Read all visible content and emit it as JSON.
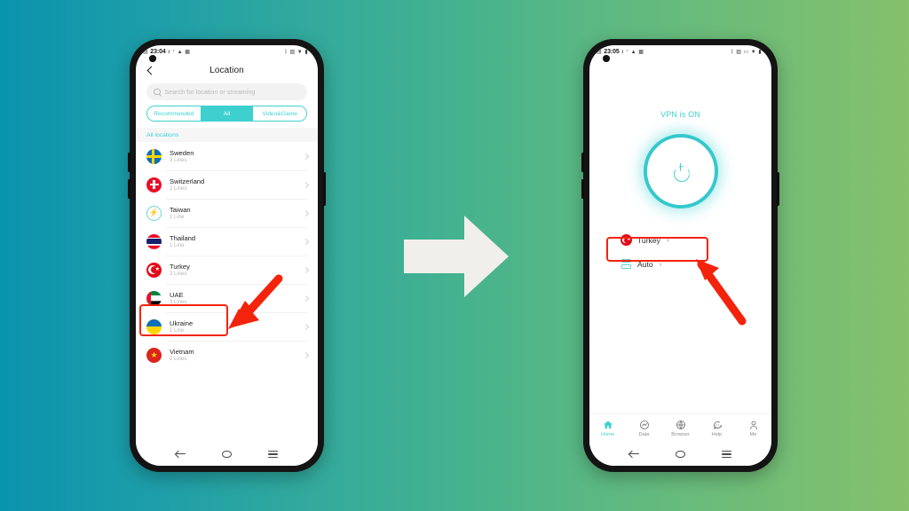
{
  "background": {
    "gradient_from": "#0a93ae",
    "gradient_to": "#85c06c"
  },
  "accent_color": "#3dd0cf",
  "highlight_color": "#f4230c",
  "center_arrow": {
    "name": "transition-arrow",
    "color": "#F0EFEA"
  },
  "left_phone": {
    "status_bar": {
      "time": "23:04",
      "left_icons": [
        "sim-icon",
        "download-icon",
        "bluetooth-small-icon",
        "alert-icon",
        "screenshot-icon"
      ],
      "right_icons": [
        "bluetooth-icon",
        "vibrate-icon",
        "wifi-icon",
        "battery-icon"
      ]
    },
    "header": {
      "title": "Location",
      "back_icon": "back-chevron-icon"
    },
    "search": {
      "placeholder": "Search for location or streaming",
      "icon": "search-icon"
    },
    "tabs": [
      {
        "label": "Recommended",
        "active": false
      },
      {
        "label": "All",
        "active": true
      },
      {
        "label": "Video&Game",
        "active": false
      }
    ],
    "section_title": "All locations",
    "locations": [
      {
        "name": "Sweden",
        "lines": "3 Lines",
        "flag": "flag-sweden"
      },
      {
        "name": "Switzerland",
        "lines": "2 Lines",
        "flag": "flag-switzerland"
      },
      {
        "name": "Taiwan",
        "lines": "1 Line",
        "flag": "icon-taiwan-bolt"
      },
      {
        "name": "Thailand",
        "lines": "1 Line",
        "flag": "flag-thailand"
      },
      {
        "name": "Turkey",
        "lines": "3 Lines",
        "flag": "flag-turkey",
        "highlighted": true
      },
      {
        "name": "UAE",
        "lines": "3 Lines",
        "flag": "flag-uae"
      },
      {
        "name": "Ukraine",
        "lines": "1 Line",
        "flag": "flag-ukraine"
      },
      {
        "name": "Vietnam",
        "lines": "2 Lines",
        "flag": "flag-vietnam"
      }
    ],
    "system_nav": [
      "back-icon",
      "home-icon",
      "recents-icon"
    ]
  },
  "right_phone": {
    "status_bar": {
      "time": "23:05",
      "left_icons": [
        "sim-icon",
        "download-icon",
        "bluetooth-small-icon",
        "alert-icon",
        "screenshot-icon"
      ],
      "right_icons": [
        "bluetooth-icon",
        "vibrate-icon",
        "vpn-icon",
        "wifi-icon",
        "battery-icon"
      ]
    },
    "vpn_status": "VPN is ON",
    "power_button": {
      "name": "vpn-power-button",
      "icon": "power-icon"
    },
    "selection": [
      {
        "name": "Turkey",
        "icon": "flag-turkey",
        "chevron": "›",
        "highlighted": true
      },
      {
        "name": "Auto",
        "icon": "auto-servers-icon",
        "chevron": "›",
        "highlighted": false
      }
    ],
    "tabbar": [
      {
        "label": "Home",
        "icon": "home-icon",
        "active": true
      },
      {
        "label": "Data",
        "icon": "data-icon",
        "active": false
      },
      {
        "label": "Browser",
        "icon": "globe-icon",
        "active": false
      },
      {
        "label": "Help",
        "icon": "chat-icon",
        "active": false
      },
      {
        "label": "Me",
        "icon": "person-icon",
        "active": false
      }
    ],
    "system_nav": [
      "back-icon",
      "home-icon",
      "recents-icon"
    ]
  }
}
